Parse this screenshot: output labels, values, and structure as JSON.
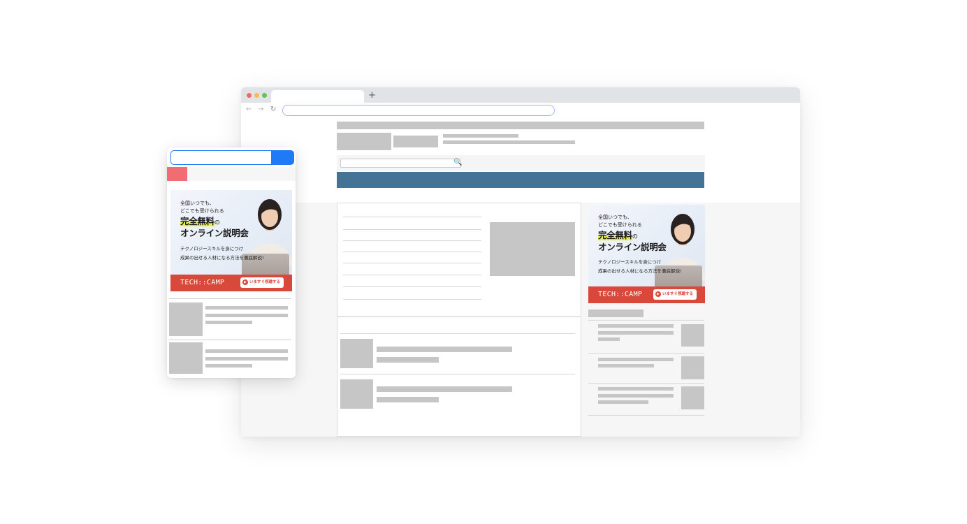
{
  "browser": {
    "window_controls": [
      {
        "name": "close",
        "color": "#ef6b5f"
      },
      {
        "name": "minimize",
        "color": "#f5bd4f"
      },
      {
        "name": "zoom",
        "color": "#61c354"
      }
    ],
    "new_tab_glyph": "+",
    "nav": {
      "back_glyph": "←",
      "forward_glyph": "→",
      "reload_glyph": "↻"
    },
    "search_glyph": "🔍",
    "navbar_color": "#447395"
  },
  "ad": {
    "line1": "全国いつでも、",
    "line2": "どこでも受けられる",
    "headline_highlight": "完全無料",
    "headline_particle": "の",
    "headline_main": "オンライン説明会",
    "desc1": "テクノロジースキルを身につけ",
    "desc2": "成果の出せる人材になる方法を徹底解説!",
    "brand": "TECH::CAMP",
    "cta_icon": "▶",
    "cta_label": "いますぐ視聴する",
    "highlight_color": "#e6f04a",
    "footer_color": "#d9493b"
  },
  "phone": {
    "search_button_color": "#1f7bf5",
    "menu_color": "#f16c73"
  }
}
